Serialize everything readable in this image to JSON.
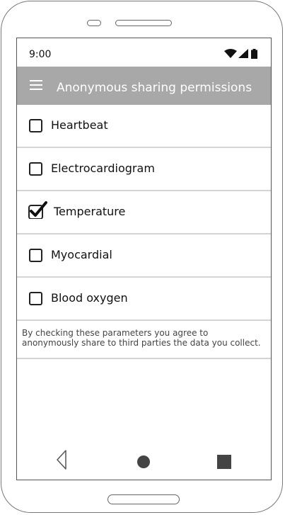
{
  "status_bar": {
    "time": "9:00",
    "icons": [
      "wifi-icon",
      "cellular-signal-icon",
      "battery-icon"
    ]
  },
  "app_bar": {
    "menu_icon": "hamburger-menu-icon",
    "title": "Anonymous sharing permissions",
    "background": "#a8a8a8"
  },
  "permissions": [
    {
      "label": "Heartbeat",
      "checked": false
    },
    {
      "label": "Electrocardiogram",
      "checked": false
    },
    {
      "label": "Temperature",
      "checked": true
    },
    {
      "label": "Myocardial",
      "checked": false
    },
    {
      "label": "Blood oxygen",
      "checked": false
    }
  ],
  "disclaimer": "By checking these parameters you agree to anonymously share to third parties the data you collect.",
  "nav_bar": {
    "buttons": [
      "back-icon",
      "home-icon",
      "recent-apps-icon"
    ]
  }
}
